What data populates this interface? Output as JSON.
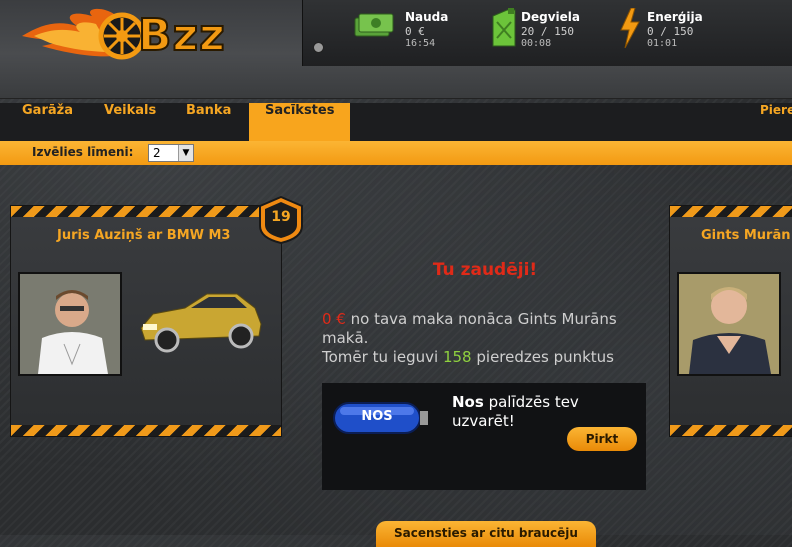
{
  "app": {
    "logo_text": "Bzz"
  },
  "stats": [
    {
      "name": "Nauda",
      "value": "0 €",
      "time": "16:54",
      "icon": "money-icon"
    },
    {
      "name": "Degviela",
      "value": "20 / 150",
      "time": "00:08",
      "icon": "fuel-can-icon"
    },
    {
      "name": "Enerģija",
      "value": "0 / 150",
      "time": "01:01",
      "icon": "lightning-icon"
    }
  ],
  "nav": {
    "tabs": [
      {
        "label": "Garāža"
      },
      {
        "label": "Veikals"
      },
      {
        "label": "Banka"
      },
      {
        "label": "Sacīkstes",
        "active": true
      }
    ],
    "right_cut": "Piere"
  },
  "level": {
    "label": "Izvēlies līmeni:",
    "selected": "2"
  },
  "player": {
    "title": "Juris Auziņš ar BMW M3",
    "level": "19"
  },
  "opponent": {
    "title": "Gints Murān"
  },
  "result": {
    "headline": "Tu zaudēji!",
    "money": "0 €",
    "money_text": " no tava maka nonāca Gints Murāns makā.",
    "xp_prefix": "Tomēr tu ieguvi ",
    "xp_value": "158",
    "xp_suffix": " pieredzes punktus"
  },
  "nos": {
    "label": "NOS",
    "bold": "Nos",
    "text": " palīdzēs tev uzvarēt!",
    "buy_label": "Pirkt"
  },
  "race_button": "Sacensties ar citu braucēju",
  "colors": {
    "accent": "#f8a51d",
    "loss": "#e02a18",
    "xp": "#8fd13f"
  }
}
